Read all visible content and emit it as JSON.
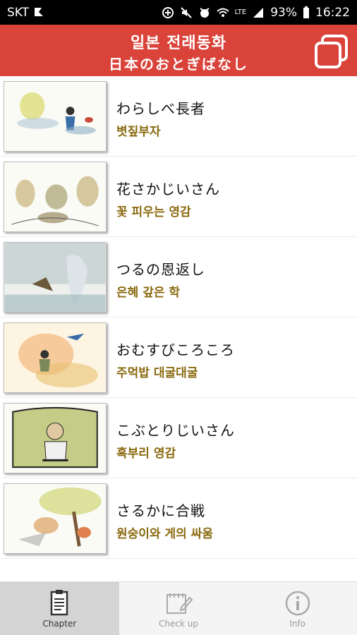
{
  "status": {
    "carrier": "SKT",
    "battery": "93%",
    "time": "16:22",
    "lte": "LTE"
  },
  "appbar": {
    "title_kr": "일본 전래동화",
    "title_jp": "日本のおとぎばなし"
  },
  "stories": [
    {
      "jp": "わらしべ長者",
      "kr": "볏짚부자"
    },
    {
      "jp": "花さかじいさん",
      "kr": "꽃 피우는 영감"
    },
    {
      "jp": "つるの恩返し",
      "kr": "은혜 갚은 학"
    },
    {
      "jp": "おむすびころころ",
      "kr": "주먹밥 대굴대굴"
    },
    {
      "jp": "こぶとりじいさん",
      "kr": "혹부리 영감"
    },
    {
      "jp": "さるかに合戦",
      "kr": "원숭이와 게의 싸움"
    }
  ],
  "tabs": [
    {
      "label": "Chapter",
      "icon": "chapter-icon"
    },
    {
      "label": "Check up",
      "icon": "checkup-icon"
    },
    {
      "label": "Info",
      "icon": "info-icon"
    }
  ],
  "colors": {
    "appbar": "#d9433a",
    "korean_text": "#8a6a10"
  }
}
